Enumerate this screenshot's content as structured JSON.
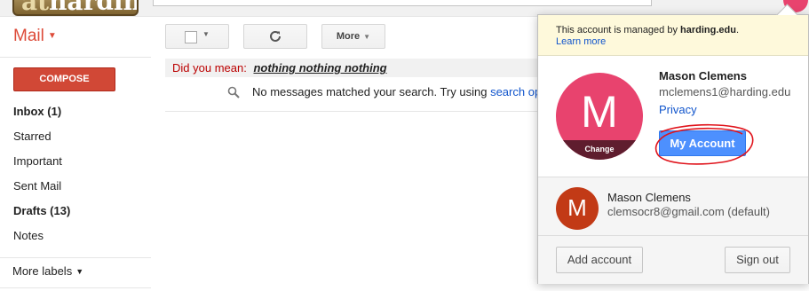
{
  "header": {
    "logo_text_a": "at",
    "logo_text_b": "harding"
  },
  "sidebar": {
    "mail_label": "Mail",
    "compose_label": "COMPOSE",
    "items": [
      {
        "label": "Inbox (1)",
        "bold": true
      },
      {
        "label": "Starred",
        "bold": false
      },
      {
        "label": "Important",
        "bold": false
      },
      {
        "label": "Sent Mail",
        "bold": false
      },
      {
        "label": "Drafts (13)",
        "bold": true
      },
      {
        "label": "Notes",
        "bold": false
      }
    ],
    "more_labels": "More labels"
  },
  "toolbar": {
    "more_label": "More"
  },
  "content": {
    "did_you_mean_prefix": "Did you mean:",
    "did_you_mean_suggestion": "nothing nothing nothing",
    "no_messages_text": "No messages matched your search. Try using",
    "no_messages_link": "search opt"
  },
  "account_popup": {
    "managed_text_prefix": "This account is managed by",
    "managed_domain": "harding.edu",
    "managed_text_suffix": ".",
    "learn_more": "Learn more",
    "avatar_letter": "M",
    "change_label": "Change",
    "name": "Mason Clemens",
    "email": "mclemens1@harding.edu",
    "privacy_link": "Privacy",
    "my_account_button": "My Account",
    "other_account": {
      "avatar_letter": "M",
      "name": "Mason Clemens",
      "email": "clemsocr8@gmail.com (default)"
    },
    "add_account_button": "Add account",
    "sign_out_button": "Sign out"
  },
  "colors": {
    "compose_red": "#d14836",
    "mail_red": "#dd4b39",
    "link_blue": "#1155cc",
    "avatar_pink": "#e8436e",
    "avatar_rust": "#c23a16",
    "primary_blue": "#4d90fe",
    "annotation_red": "#e0141c"
  }
}
